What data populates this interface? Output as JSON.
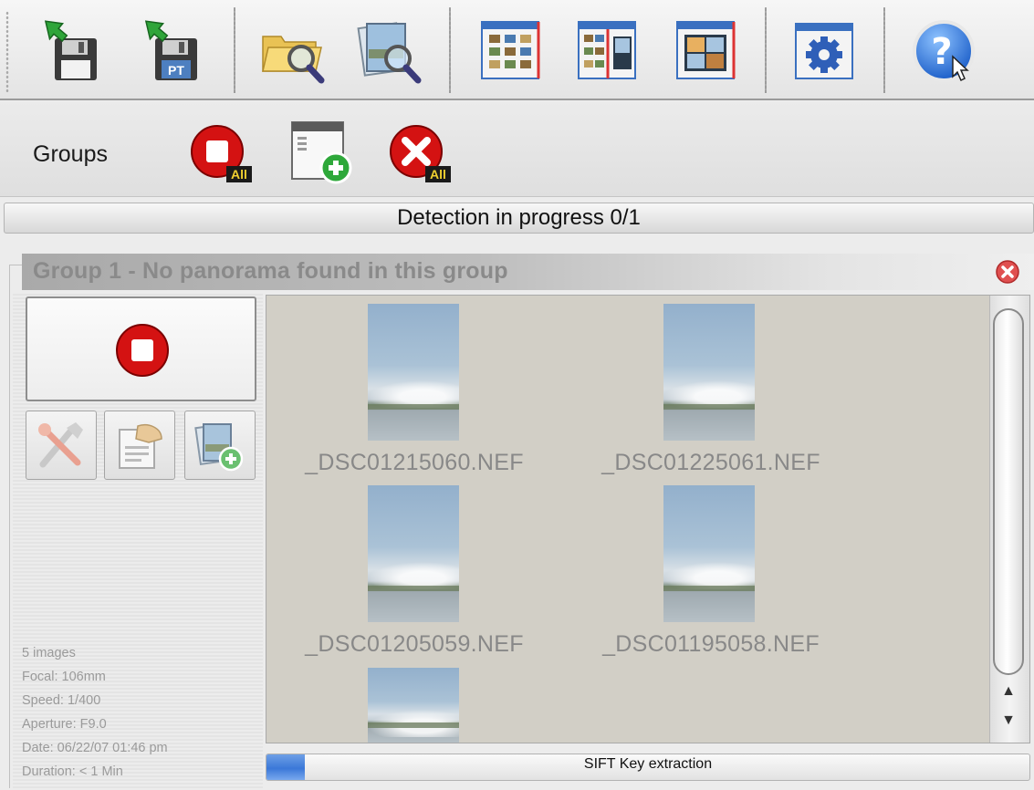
{
  "toolbar": {
    "buttons": [
      {
        "name": "export-button",
        "icon": "floppy-export-icon"
      },
      {
        "name": "export-pt-button",
        "icon": "floppy-pt-export-icon",
        "badge": "PT"
      },
      {
        "name": "open-folder-button",
        "icon": "folder-search-icon"
      },
      {
        "name": "search-images-button",
        "icon": "image-search-icon"
      },
      {
        "name": "view-grid-button",
        "icon": "grid-view-icon"
      },
      {
        "name": "view-list-button",
        "icon": "list-view-icon"
      },
      {
        "name": "view-single-button",
        "icon": "single-view-icon"
      },
      {
        "name": "settings-button",
        "icon": "gear-icon"
      },
      {
        "name": "help-button",
        "icon": "help-icon",
        "glyph": "?"
      }
    ]
  },
  "groups_bar": {
    "label": "Groups",
    "stop_all_badge": "All",
    "close_all_badge": "All"
  },
  "detection_status": "Detection in progress 0/1",
  "group": {
    "title": "Group 1 - No panorama found in this group",
    "thumbnails": [
      {
        "filename": "_DSC01215060.NEF"
      },
      {
        "filename": "_DSC01225061.NEF"
      },
      {
        "filename": "_DSC01205059.NEF"
      },
      {
        "filename": "_DSC01195058.NEF"
      },
      {
        "filename": ""
      }
    ],
    "info": {
      "images": "5 images",
      "focal": "Focal: 106mm",
      "speed": "Speed: 1/400",
      "aperture": "Aperture: F9.0",
      "date": "Date: 06/22/07 01:46 pm",
      "duration": "Duration: < 1 Min"
    }
  },
  "progress": {
    "label": "SIFT Key extraction",
    "value": 0.05
  },
  "colors": {
    "stop_red": "#d41212",
    "accent_blue": "#3b78d8",
    "thumb_bg": "#d2cfc6"
  }
}
